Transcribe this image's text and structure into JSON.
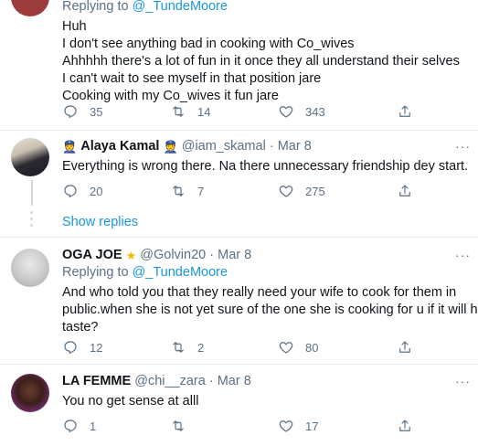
{
  "top_reply": {
    "replying_prefix": "Replying to",
    "replying_handle": "@_TundeMoore",
    "lines": [
      "Huh",
      "I don't see anything bad in cooking with Co_wives",
      "Ahhhhh there's a lot of fun in it once they all understand their selves",
      "I can't wait to  see myself in that position jare",
      "Cooking with my Co_wives it fun jare"
    ],
    "replies": "35",
    "retweets": "14",
    "likes": "343"
  },
  "alaya": {
    "name": "Alaya Kamal",
    "handle": "@iam_skamal",
    "date": "Mar 8",
    "text": "Everything is wrong there. Na there unnecessary friendship dey start.",
    "replies": "20",
    "retweets": "7",
    "likes": "275",
    "show_replies": "Show replies"
  },
  "ogajoe": {
    "name": "OGA JOE",
    "handle": "@Golvin20",
    "date": "Mar 8",
    "replying_prefix": "Replying to",
    "replying_handle": "@_TundeMoore",
    "lines": [
      "And who told you that they really need your wife to cook for them in",
      "public.when she is not yet sure of the one she is cooking for u if it will have",
      "taste?"
    ],
    "replies": "12",
    "retweets": "2",
    "likes": "80"
  },
  "lafemme": {
    "name": "LA FEMME",
    "handle": "@chi__zara",
    "date": "Mar 8",
    "text": "You no get sense at alll",
    "replies": "1",
    "retweets": "",
    "likes": "17"
  },
  "separator": "·",
  "more_glyph": "···",
  "icons": [
    "reply-icon",
    "retweet-icon",
    "like-icon",
    "share-icon",
    "more-icon",
    "pilot-emoji-icon",
    "star-emoji-icon"
  ],
  "colors": {
    "link": "#1b95e0",
    "muted": "#5b7083",
    "divider": "#e6ecf0",
    "star": "#f5b70a"
  }
}
